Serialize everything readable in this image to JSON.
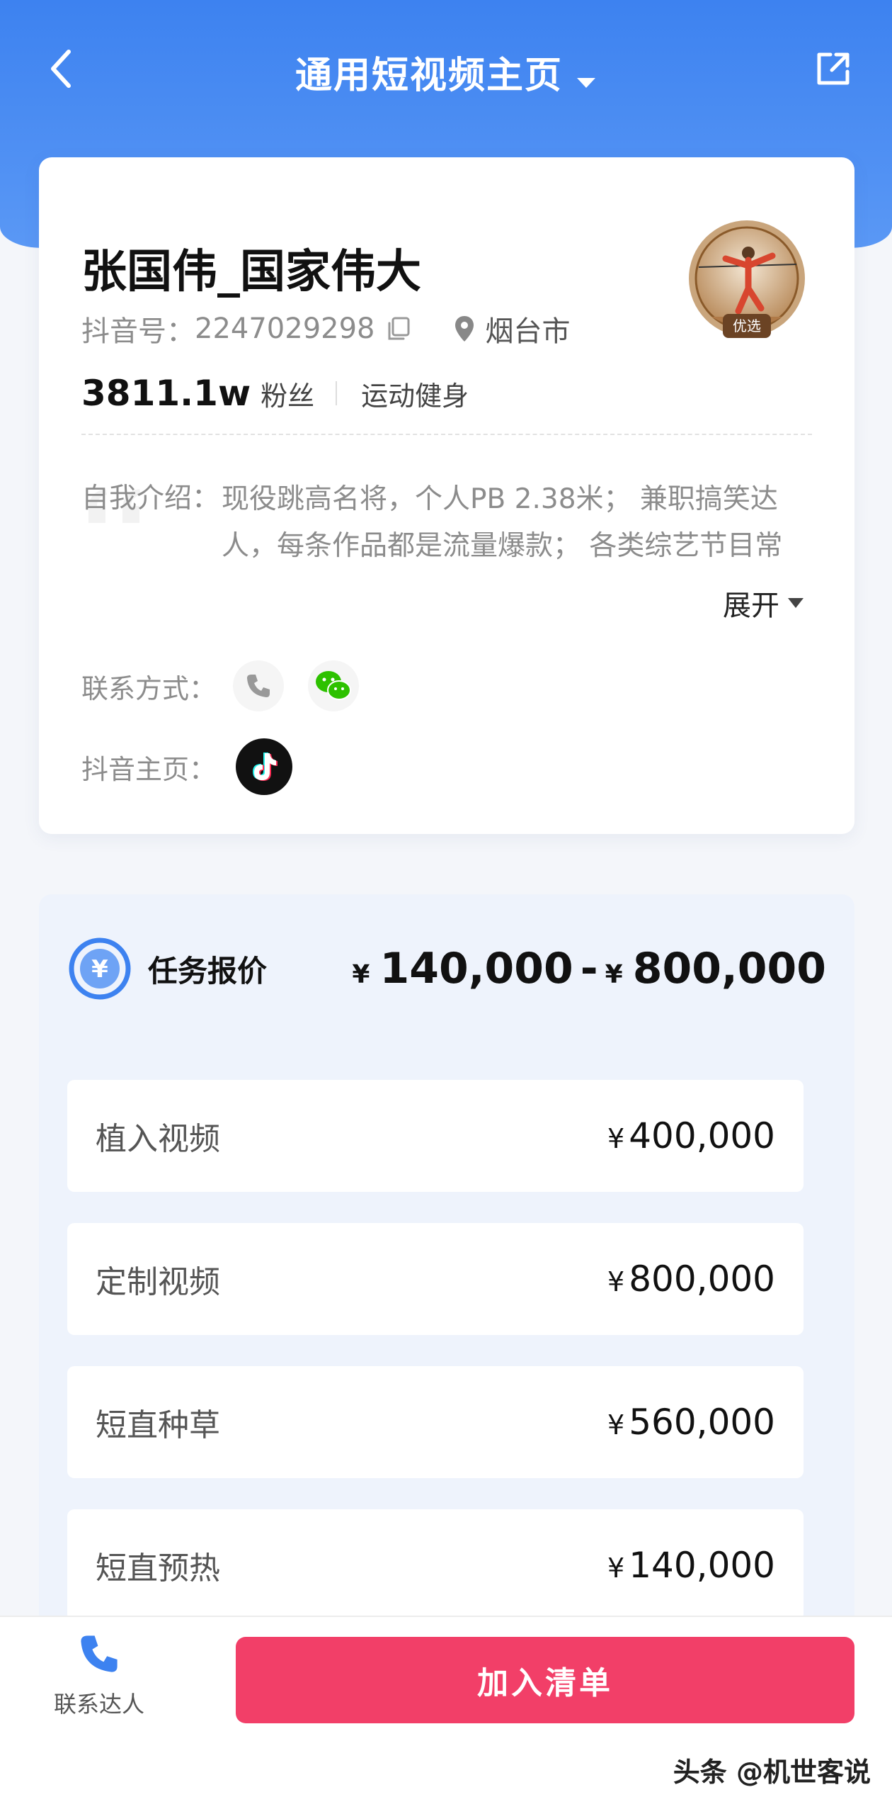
{
  "header": {
    "title": "通用短视频主页",
    "back_icon": "chevron-left-icon",
    "share_icon": "share-external-icon"
  },
  "profile": {
    "name": "张国伟_国家伟大",
    "id_label": "抖音号：",
    "id_value": "2247029298",
    "location": "烟台市",
    "fans_count": "3811.1w",
    "fans_label": "粉丝",
    "category": "运动健身",
    "avatar_badge": "优选",
    "intro_label": "自我介绍：",
    "intro_text": "现役跳高名将，个人PB 2.38米； 兼职搞笑达人，每条作品都是流量爆款； 各类综艺节目常",
    "expand_label": "展开",
    "contact_label": "联系方式：",
    "douyin_label": "抖音主页："
  },
  "pricing": {
    "title": "任务报价",
    "currency": "¥",
    "range_min": "140,000",
    "range_max": "800,000",
    "items": [
      {
        "label": "植入视频",
        "value": "400,000"
      },
      {
        "label": "定制视频",
        "value": "800,000"
      },
      {
        "label": "短直种草",
        "value": "560,000"
      },
      {
        "label": "短直预热",
        "value": "140,000"
      }
    ]
  },
  "footer": {
    "contact_label": "联系达人",
    "add_label": "加入清单"
  },
  "watermark": "头条 @机世客说",
  "colors": {
    "brand_blue": "#3d82f0",
    "add_button": "#f23f68",
    "wechat_green": "#2dc100"
  }
}
